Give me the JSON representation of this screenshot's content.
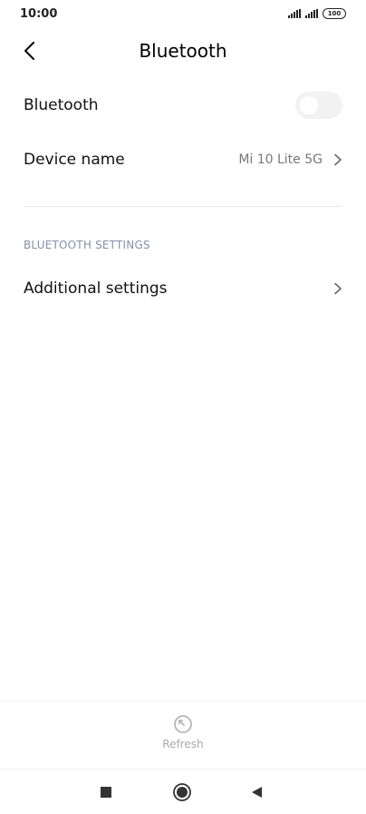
{
  "status_bar": {
    "time": "10:00",
    "battery": "100"
  },
  "header": {
    "title": "Bluetooth",
    "back_icon": "chevron-left-icon"
  },
  "bluetooth_row": {
    "label": "Bluetooth",
    "toggle_on": false
  },
  "device_name_row": {
    "label": "Device name",
    "value": "Mi 10 Lite 5G"
  },
  "section": {
    "header": "BLUETOOTH SETTINGS"
  },
  "additional_settings_row": {
    "label": "Additional settings"
  },
  "bottom_bar": {
    "refresh_label": "Refresh",
    "refresh_icon": "refresh-icon"
  },
  "nav_bar": {
    "recents_icon": "square-icon",
    "home_icon": "circle-icon",
    "back_icon": "triangle-back-icon"
  },
  "colors": {
    "section_header": "#8690a8",
    "toggle_track_off": "#f2f2f2",
    "secondary_text": "#777777"
  }
}
